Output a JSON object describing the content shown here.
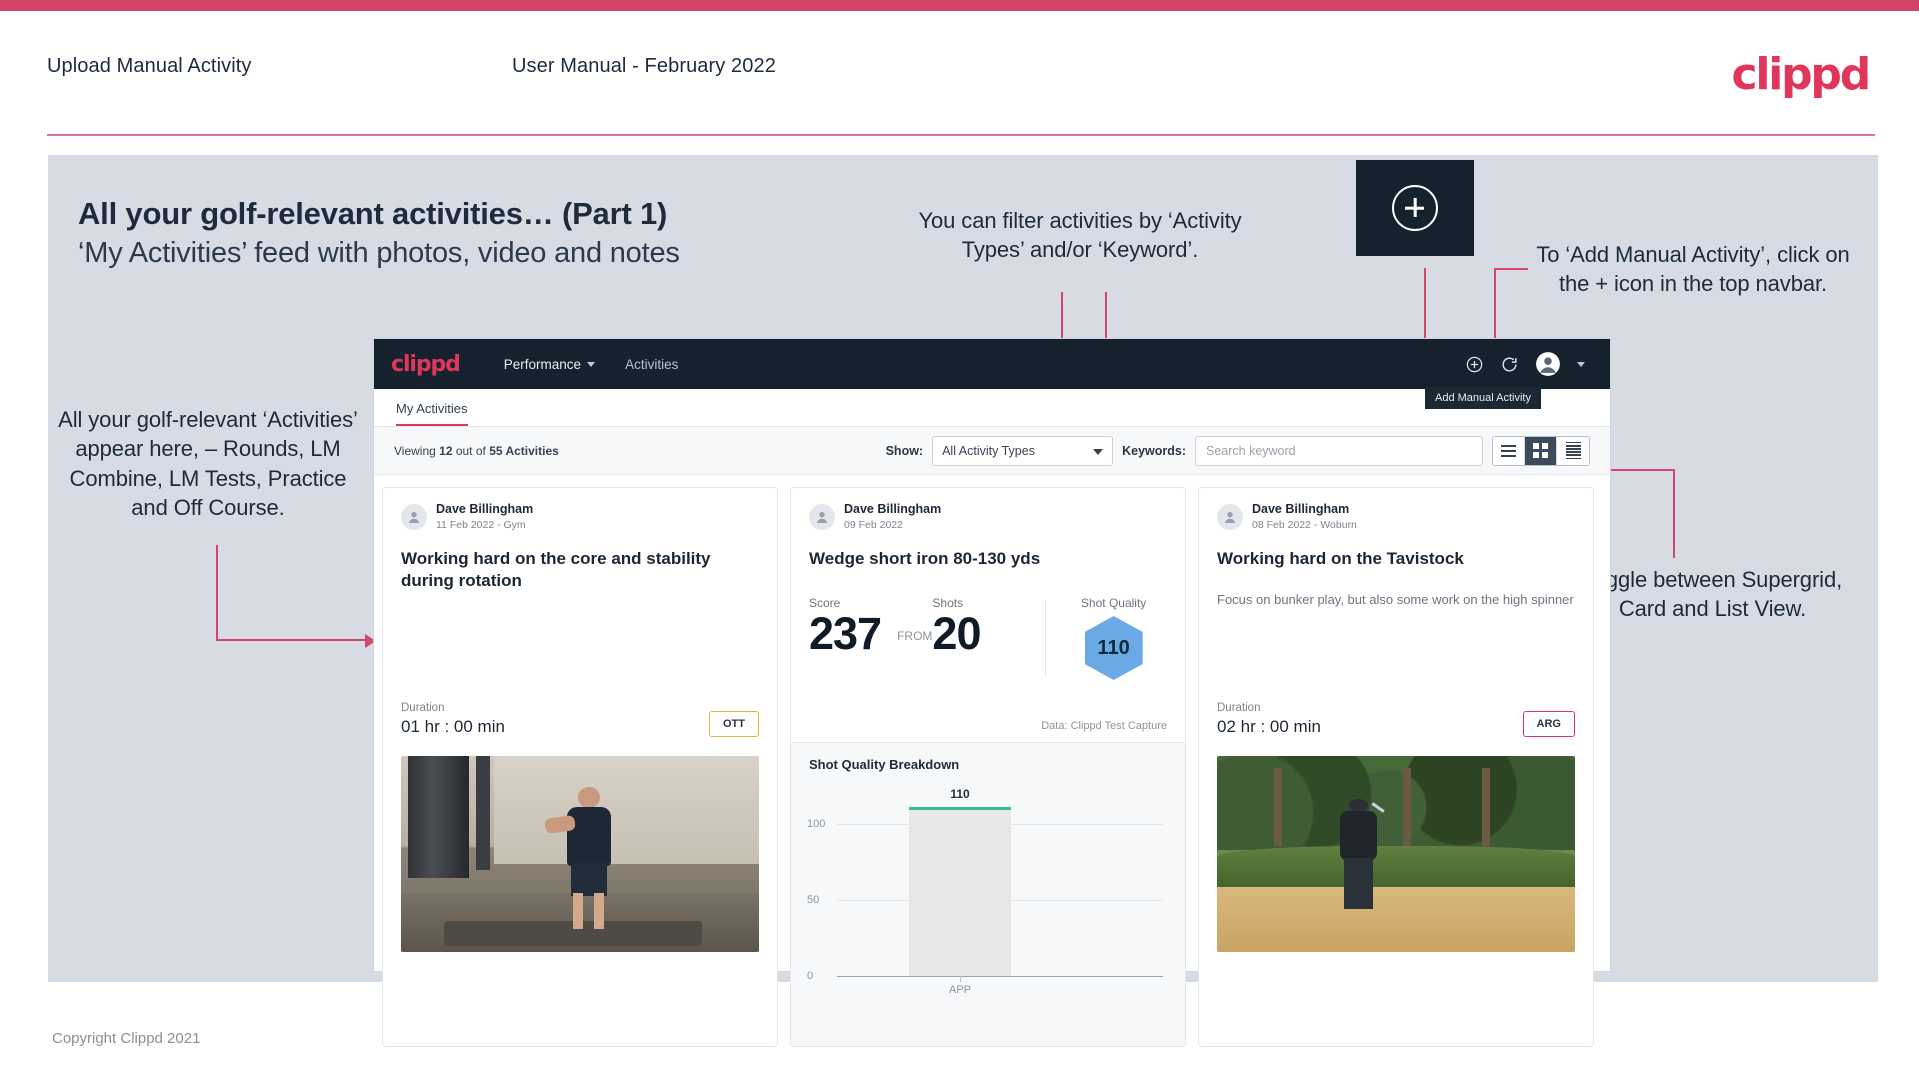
{
  "slide": {
    "header_left": "Upload Manual Activity",
    "header_center": "User Manual - February 2022",
    "brand_logo": "clippd",
    "title": "All your golf-relevant activities… (Part 1)",
    "subtitle": "‘My Activities’ feed with photos, video and notes",
    "footer": "Copyright Clippd 2021"
  },
  "annotations": {
    "filter": "You can filter activities by ‘Activity Types’ and/or ‘Keyword’.",
    "add_manual": "To ‘Add Manual Activity’, click on the + icon in the top navbar.",
    "left": "All your golf-relevant ‘Activities’ appear here, – Rounds, LM Combine, LM Tests, Practice and Off Course.",
    "toggle": "Toggle between Supergrid, Card and List View."
  },
  "colors": {
    "brand_pink": "#e0365c",
    "annotation_line": "#d4476b",
    "navbar_dark": "#16212e",
    "stage_bg": "#d7dce4",
    "hex_blue": "#6aaae4",
    "bar_cap_green": "#35c08a"
  },
  "app": {
    "navbar": {
      "logo": "clippd",
      "links": [
        {
          "label": "Performance",
          "has_caret": true
        },
        {
          "label": "Activities",
          "has_caret": false
        }
      ],
      "tooltip": "Add Manual Activity"
    },
    "tabs": [
      {
        "label": "My Activities",
        "active": true
      }
    ],
    "toolbar": {
      "viewing_prefix": "Viewing ",
      "viewing_count": "12",
      "viewing_mid": " out of ",
      "viewing_total": "55 Activities",
      "show_label": "Show:",
      "activity_type_value": "All Activity Types",
      "keywords_label": "Keywords:",
      "keyword_placeholder": "Search keyword",
      "views": [
        {
          "name": "supergrid-view",
          "active": false
        },
        {
          "name": "card-view",
          "active": true
        },
        {
          "name": "list-view",
          "active": false
        }
      ]
    },
    "cards": [
      {
        "user": "Dave Billingham",
        "meta": "11 Feb 2022 - Gym",
        "title": "Working hard on the core and stability during rotation",
        "duration_label": "Duration",
        "duration_value": "01 hr : 00 min",
        "tag": "OTT"
      },
      {
        "user": "Dave Billingham",
        "meta": "09 Feb 2022",
        "title": "Wedge short iron 80-130 yds",
        "score_label": "Score",
        "score_value": "237",
        "from_label": "FROM",
        "shots_label": "Shots",
        "shots_value": "20",
        "quality_label": "Shot Quality",
        "quality_value": "110",
        "data_source": "Data: Clippd Test Capture"
      },
      {
        "user": "Dave Billingham",
        "meta": "08 Feb 2022 - Woburn",
        "title": "Working hard on the Tavistock",
        "note": "Focus on bunker play, but also some work on the high spinner",
        "duration_label": "Duration",
        "duration_value": "02 hr : 00 min",
        "tag": "ARG"
      }
    ]
  },
  "chart_data": {
    "type": "bar",
    "title": "Shot Quality Breakdown",
    "categories": [
      "APP"
    ],
    "values": [
      110
    ],
    "data_labels": [
      "110"
    ],
    "xlabel": "",
    "ylabel": "",
    "ylim": [
      0,
      120
    ],
    "yticks": [
      0,
      50,
      100
    ],
    "ytick_labels": [
      "0",
      "50",
      "100"
    ],
    "grid": true,
    "legend": "none",
    "bar_color": "#e6e7e7",
    "bar_cap_color": "#35c08a"
  }
}
